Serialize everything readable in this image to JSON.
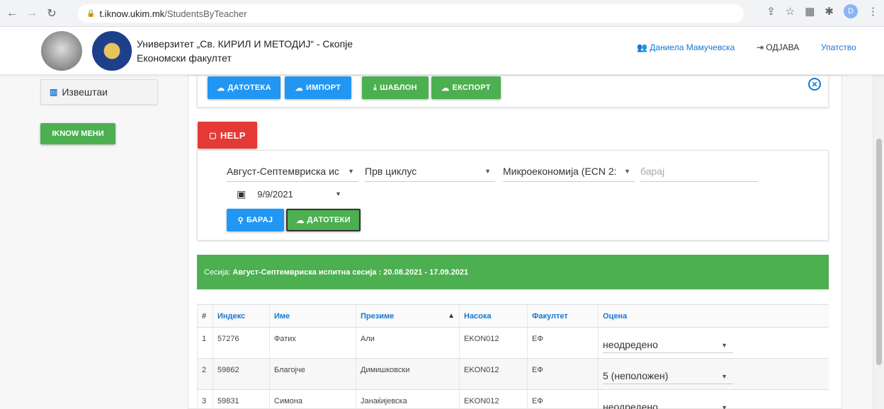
{
  "browser": {
    "url_host": "t.iknow.ukim.mk",
    "url_path": "/StudentsByTeacher",
    "profile_initial": "D"
  },
  "header": {
    "university": "Универзитет „Св. КИРИЛ И МЕТОДИЈ“ - Скопје",
    "faculty": "Економски факултет",
    "user_name": "Даниела Мамучевска",
    "logout_label": "ОДЈАВА",
    "guide_label": "Упатство"
  },
  "sidebar": {
    "reports_label": "Извештаи",
    "iknow_menu_label": "IKNOW МЕНИ"
  },
  "toolbar": {
    "file_label": "ДАТОТЕКА",
    "import_label": "ИМПОРТ",
    "template_label": "ШАБЛОН",
    "export_label": "ЕКСПОРТ"
  },
  "help_label": "HELP",
  "filters": {
    "session_value": "Август-Септемвриска ис",
    "cycle_value": "Прв циклус",
    "subject_value": "Микроекономија (ECN 2:",
    "search_placeholder": "барај",
    "date_value": "9/9/2021",
    "search_button": "БАРАЈ",
    "files_button": "ДАТОТЕКИ"
  },
  "session_banner": {
    "prefix": "Сесија:",
    "value": "Август-Септемвриска испитна сесија : 20.08.2021 - 17.09.2021"
  },
  "table": {
    "headers": [
      "#",
      "Индекс",
      "Име",
      "Презиме",
      "Насока",
      "Факултет",
      "Оцена"
    ],
    "rows": [
      {
        "num": "1",
        "index": "57276",
        "first": "Фатих",
        "last": "Али",
        "track": "EKON012",
        "faculty": "ЕФ",
        "grade": "неодредено"
      },
      {
        "num": "2",
        "index": "59862",
        "first": "Благојче",
        "last": "Димишковски",
        "track": "EKON012",
        "faculty": "ЕФ",
        "grade": "5 (неположен)"
      },
      {
        "num": "3",
        "index": "59831",
        "first": "Симона",
        "last": "Јанаќијевска",
        "track": "EKON012",
        "faculty": "ЕФ",
        "grade": "неодредено"
      }
    ]
  },
  "colors": {
    "primary_blue": "#2196f3",
    "green": "#4caf50",
    "red": "#e53935",
    "link_blue": "#1976d2"
  }
}
